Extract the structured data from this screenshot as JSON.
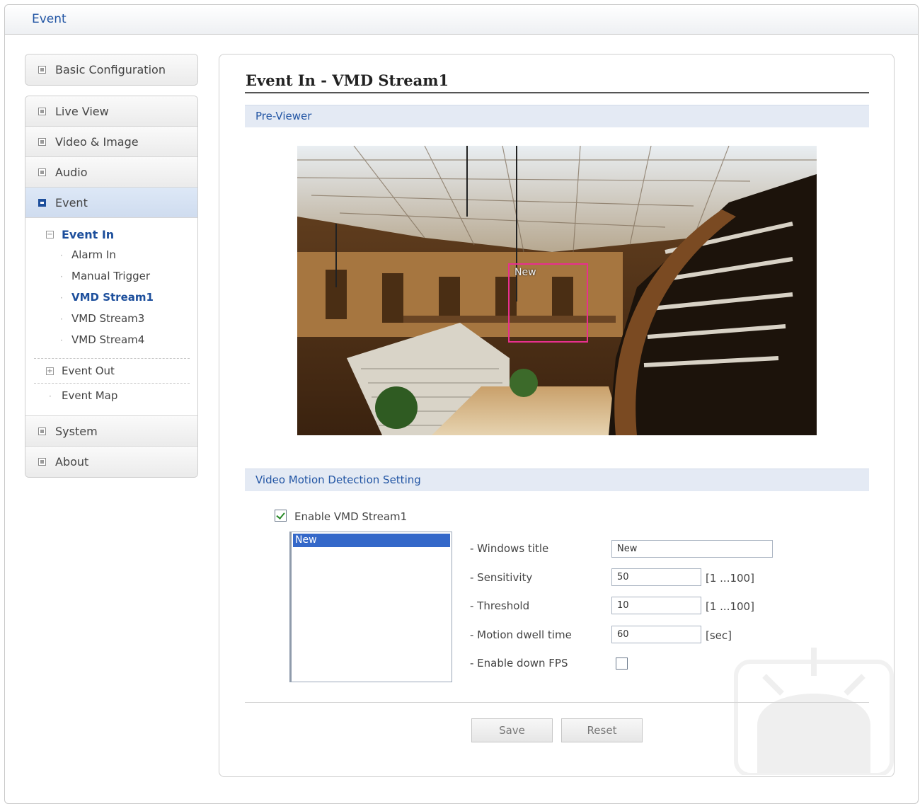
{
  "window": {
    "title": "Event"
  },
  "sidebar": {
    "top_item": "Basic Configuration",
    "items": [
      "Live View",
      "Video & Image",
      "Audio",
      "Event"
    ],
    "event_tree": {
      "event_in": "Event In",
      "event_in_children": [
        "Alarm In",
        "Manual Trigger",
        "VMD Stream1",
        "VMD Stream3",
        "VMD Stream4"
      ],
      "selected": "VMD Stream1",
      "event_out": "Event Out",
      "event_map": "Event Map"
    },
    "bottom_items": [
      "System",
      "About"
    ]
  },
  "page": {
    "title": "Event In - VMD Stream1",
    "preview_section": "Pre-Viewer",
    "motion_zone_label": "New",
    "settings_section": "Video Motion Detection Setting",
    "enable_label": "Enable VMD Stream1",
    "enable_checked": true,
    "window_list": [
      "New"
    ],
    "fields": {
      "windows_title_label": "- Windows title",
      "windows_title_value": "New",
      "sensitivity_label": "- Sensitivity",
      "sensitivity_value": "50",
      "sensitivity_range": "[1 ...100]",
      "threshold_label": "- Threshold",
      "threshold_value": "10",
      "threshold_range": "[1 ...100]",
      "dwell_label": "- Motion dwell time",
      "dwell_value": "60",
      "dwell_unit": "[sec]",
      "down_fps_label": "- Enable down FPS",
      "down_fps_checked": false
    },
    "buttons": {
      "save": "Save",
      "reset": "Reset"
    }
  },
  "colors": {
    "accent": "#2255a4",
    "motion_zone": "#e8308e",
    "selection": "#3468c9"
  }
}
